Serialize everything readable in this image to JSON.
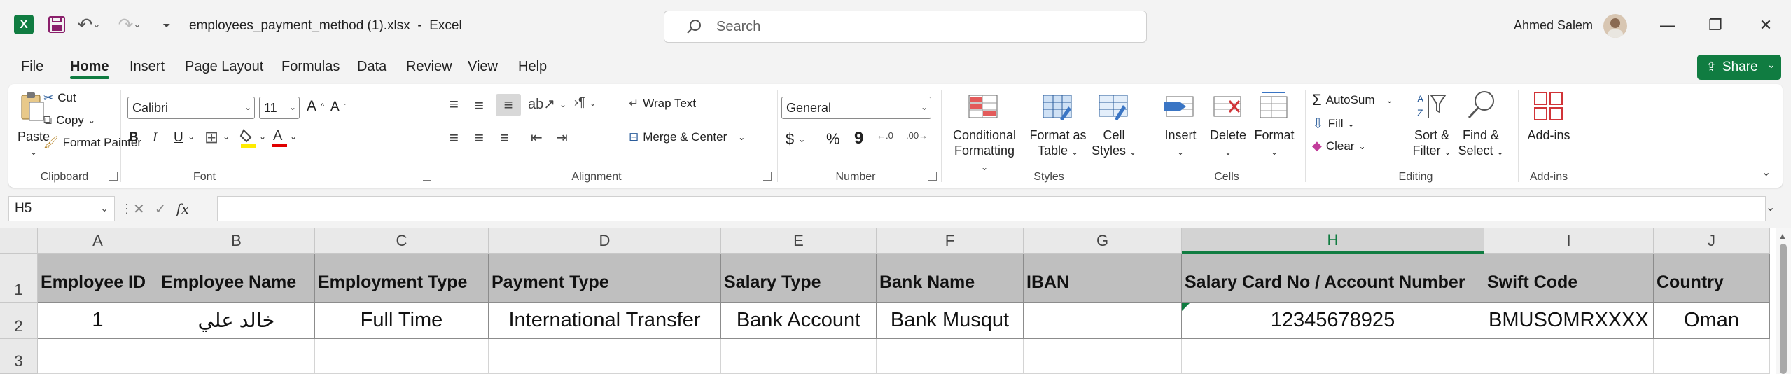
{
  "titlebar": {
    "app_icon_letter": "X",
    "file_name": "employees_payment_method (1).xlsx",
    "separator": "-",
    "app_name": "Excel",
    "search_placeholder": "Search",
    "user_name": "Ahmed Salem"
  },
  "tabs": [
    "File",
    "Home",
    "Insert",
    "Page Layout",
    "Formulas",
    "Data",
    "Review",
    "View",
    "Help"
  ],
  "active_tab": "Home",
  "share_label": "Share",
  "ribbon": {
    "clipboard": {
      "paste": "Paste",
      "cut": "Cut",
      "copy": "Copy",
      "format_painter": "Format Painter",
      "label": "Clipboard"
    },
    "font": {
      "name": "Calibri",
      "size": "11",
      "bold": "B",
      "italic": "I",
      "underline": "U",
      "label": "Font"
    },
    "alignment": {
      "wrap": "Wrap Text",
      "merge": "Merge & Center",
      "label": "Alignment"
    },
    "number": {
      "format": "General",
      "currency": "$",
      "percent": "%",
      "comma": "9",
      "label": "Number"
    },
    "styles": {
      "conditional_1": "Conditional",
      "conditional_2": "Formatting",
      "format_table_1": "Format as",
      "format_table_2": "Table",
      "cell_styles_1": "Cell",
      "cell_styles_2": "Styles",
      "label": "Styles"
    },
    "cells": {
      "insert": "Insert",
      "delete": "Delete",
      "format": "Format",
      "label": "Cells"
    },
    "editing": {
      "autosum": "AutoSum",
      "fill": "Fill",
      "clear": "Clear",
      "sort_1": "Sort &",
      "sort_2": "Filter",
      "find_1": "Find &",
      "find_2": "Select",
      "label": "Editing"
    },
    "addins": {
      "button": "Add-ins",
      "label": "Add-ins"
    }
  },
  "formula_bar": {
    "name_box": "H5",
    "fx": "fx",
    "formula": ""
  },
  "sheet": {
    "columns": [
      "A",
      "B",
      "C",
      "D",
      "E",
      "F",
      "G",
      "H",
      "I",
      "J"
    ],
    "rows": [
      "1",
      "2",
      "3"
    ],
    "header_row": [
      "Employee ID",
      "Employee Name",
      "Employment Type",
      "Payment Type",
      "Salary Type",
      "Bank Name",
      "IBAN",
      "Salary Card No / Account Number",
      "Swift Code",
      "Country"
    ],
    "data_row": [
      "1",
      "خالد علي",
      "Full Time",
      "International Transfer",
      "Bank Account",
      "Bank Musqut",
      "",
      "12345678925",
      "BMUSOMRXXXX",
      "Oman"
    ]
  }
}
